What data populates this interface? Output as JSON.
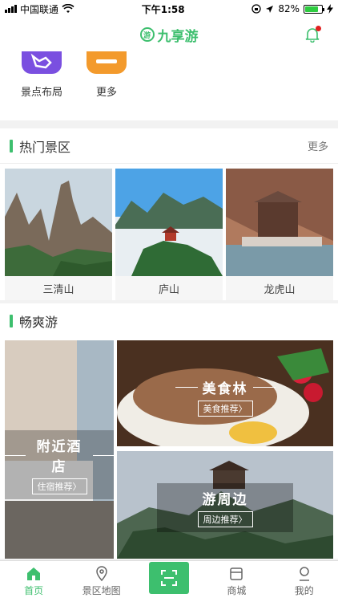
{
  "status_bar": {
    "carrier": "中国联通",
    "time": "下午1:58",
    "battery": "82%",
    "battery_level": 0.82
  },
  "header": {
    "title": "九享游",
    "logo_glyph": "游"
  },
  "shortcuts": [
    {
      "label": "景点布局",
      "color": "#7a4fe0",
      "icon": "map-layout-icon"
    },
    {
      "label": "更多",
      "color": "#f39a2c",
      "icon": "more-icon"
    }
  ],
  "hot_section": {
    "title": "热门景区",
    "more": "更多",
    "spots": [
      {
        "name": "三清山"
      },
      {
        "name": "庐山"
      },
      {
        "name": "龙虎山"
      }
    ]
  },
  "fun_section": {
    "title": "畅爽游",
    "cards": [
      {
        "title": "附近酒店",
        "sub": "住宿推荐〉"
      },
      {
        "title": "美食林",
        "sub": "美食推荐〉"
      },
      {
        "title": "游周边",
        "sub": "周边推荐〉"
      }
    ]
  },
  "tabs": [
    {
      "label": "首页",
      "icon": "home-icon",
      "active": true
    },
    {
      "label": "景区地图",
      "icon": "map-pin-icon",
      "active": false
    },
    {
      "label": "",
      "icon": "scan-icon",
      "active": false
    },
    {
      "label": "商城",
      "icon": "shop-icon",
      "active": false
    },
    {
      "label": "我的",
      "icon": "user-icon",
      "active": false
    }
  ],
  "colors": {
    "accent": "#3dbf6e",
    "badge": "#e02020"
  }
}
